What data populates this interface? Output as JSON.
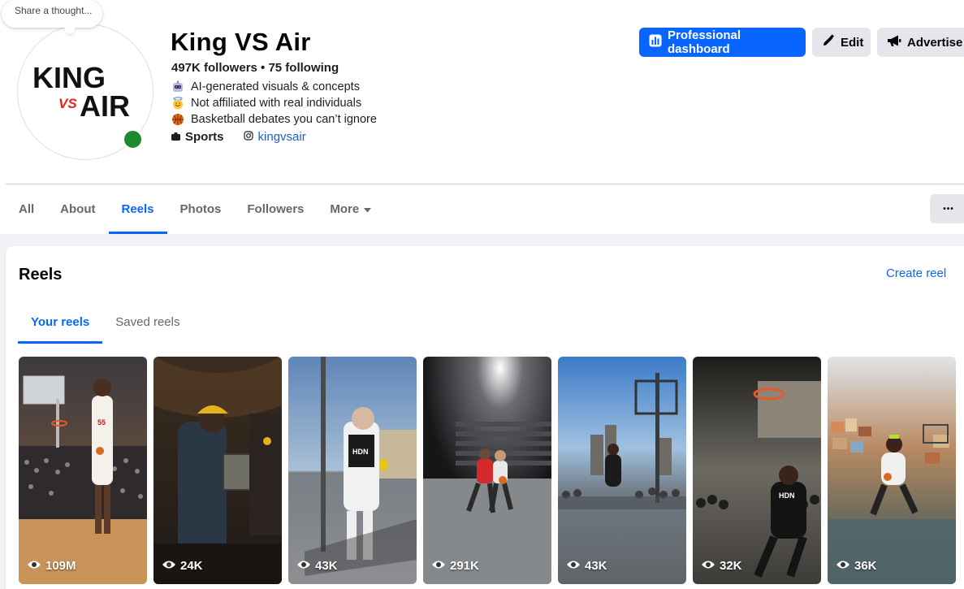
{
  "thought_prompt": "Share a thought...",
  "profile": {
    "name": "King VS Air",
    "stats": "497K followers • 75 following",
    "bio": [
      {
        "icon": "robot-face-icon",
        "text": "AI-generated visuals & concepts"
      },
      {
        "icon": "halo-face-icon",
        "text": "Not affiliated with real individuals"
      },
      {
        "icon": "basketball-icon",
        "text": "Basketball debates you can’t ignore"
      }
    ],
    "category": "Sports",
    "instagram": "kingvsair",
    "logo": {
      "line1": "KING",
      "vs": "VS",
      "line2": "AIR"
    }
  },
  "actions": {
    "dashboard": "Professional dashboard",
    "edit": "Edit",
    "advertise": "Advertise"
  },
  "tabs": [
    {
      "label": "All"
    },
    {
      "label": "About"
    },
    {
      "label": "Reels"
    },
    {
      "label": "Photos"
    },
    {
      "label": "Followers"
    },
    {
      "label": "More"
    }
  ],
  "more_menu_glyph": "•••",
  "reels": {
    "title": "Reels",
    "create": "Create reel",
    "tabs": [
      "Your reels",
      "Saved reels"
    ],
    "items": [
      {
        "views": "109M"
      },
      {
        "views": "24K"
      },
      {
        "views": "43K"
      },
      {
        "views": "291K"
      },
      {
        "views": "43K"
      },
      {
        "views": "32K"
      },
      {
        "views": "36K"
      }
    ]
  },
  "colors": {
    "accent": "#0866ff",
    "online": "#1d8a2f"
  }
}
